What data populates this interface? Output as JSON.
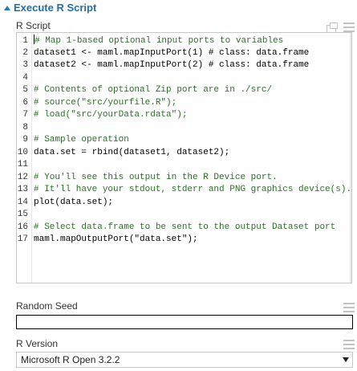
{
  "panel": {
    "title": "Execute R Script"
  },
  "r_script": {
    "label": "R Script",
    "lines": [
      {
        "num": "1",
        "text": " Map 1-based optional input ports to variables",
        "kind": "comment",
        "cursor": true
      },
      {
        "num": "2",
        "text": "dataset1 <- maml.mapInputPort(1) # class: data.frame",
        "kind": "code"
      },
      {
        "num": "3",
        "text": "dataset2 <- maml.mapInputPort(2) # class: data.frame",
        "kind": "code"
      },
      {
        "num": "4",
        "text": "",
        "kind": "code"
      },
      {
        "num": "5",
        "text": "# Contents of optional Zip port are in ./src/",
        "kind": "comment"
      },
      {
        "num": "6",
        "text": "# source(\"src/yourfile.R\");",
        "kind": "comment"
      },
      {
        "num": "7",
        "text": "# load(\"src/yourData.rdata\");",
        "kind": "comment"
      },
      {
        "num": "8",
        "text": "",
        "kind": "code"
      },
      {
        "num": "9",
        "text": "# Sample operation",
        "kind": "comment"
      },
      {
        "num": "10",
        "text": "data.set = rbind(dataset1, dataset2);",
        "kind": "code"
      },
      {
        "num": "11",
        "text": "",
        "kind": "code"
      },
      {
        "num": "12",
        "text": "# You'll see this output in the R Device port.",
        "kind": "comment"
      },
      {
        "num": "13",
        "text": "# It'll have your stdout, stderr and PNG graphics device(s).",
        "kind": "comment"
      },
      {
        "num": "14",
        "text": "plot(data.set);",
        "kind": "code"
      },
      {
        "num": "15",
        "text": "",
        "kind": "code"
      },
      {
        "num": "16",
        "text": "# Select data.frame to be sent to the output Dataset port",
        "kind": "comment"
      },
      {
        "num": "17",
        "text": "maml.mapOutputPort(\"data.set\");",
        "kind": "code"
      }
    ]
  },
  "random_seed": {
    "label": "Random Seed",
    "value": ""
  },
  "r_version": {
    "label": "R Version",
    "selected": "Microsoft R Open 3.2.2"
  },
  "colors": {
    "accent": "#1f6fae",
    "comment": "#2d6f2a",
    "icon": "#c3c3c3"
  },
  "icons": {
    "collapse": "triangle-up-icon",
    "menu": "hamburger-icon",
    "popout": "popout-icon",
    "dropdown": "dropdown-arrow-icon"
  }
}
